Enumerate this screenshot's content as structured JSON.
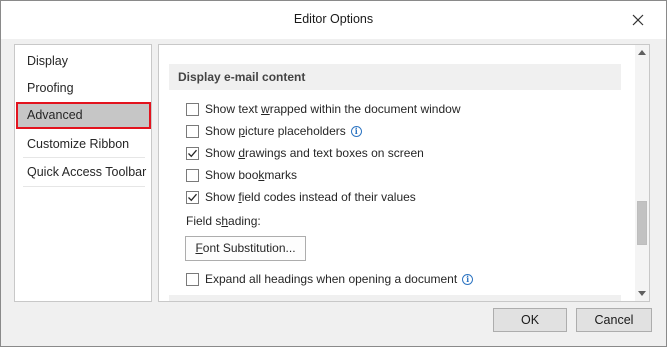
{
  "window": {
    "title": "Editor Options"
  },
  "nav": {
    "items": [
      {
        "label": "Display",
        "selected": false
      },
      {
        "label": "Proofing",
        "selected": false
      },
      {
        "label": "Advanced",
        "selected": true
      },
      {
        "label": "Customize Ribbon",
        "selected": false
      },
      {
        "label": "Quick Access Toolbar",
        "selected": false
      }
    ]
  },
  "content": {
    "section_title": "Display e-mail content",
    "options": [
      {
        "pre": "Show text ",
        "mn": "w",
        "post": "rapped within the document window",
        "checked": false,
        "info": false
      },
      {
        "pre": "Show ",
        "mn": "p",
        "post": "icture placeholders",
        "checked": false,
        "info": true
      },
      {
        "pre": "Show ",
        "mn": "d",
        "post": "rawings and text boxes on screen",
        "checked": true,
        "info": false
      },
      {
        "pre": "Show boo",
        "mn": "k",
        "post": "marks",
        "checked": false,
        "info": false
      },
      {
        "pre": "Show ",
        "mn": "f",
        "post": "ield codes instead of their values",
        "checked": true,
        "info": false
      }
    ],
    "field_shading": {
      "pre": "Field s",
      "mn": "h",
      "post": "ading:"
    },
    "font_button": {
      "pre": "",
      "mn": "F",
      "post": "ont Substitution..."
    },
    "expand_option": {
      "pre": "Expand all headings when opening a document",
      "mn": "",
      "post": "",
      "checked": false,
      "info": true
    }
  },
  "footer": {
    "ok_label": "OK",
    "cancel_label": "Cancel"
  },
  "colors": {
    "selection_outline": "#e3131e",
    "selection_fill": "#c6c6c6",
    "info_icon": "#2e75c2"
  }
}
